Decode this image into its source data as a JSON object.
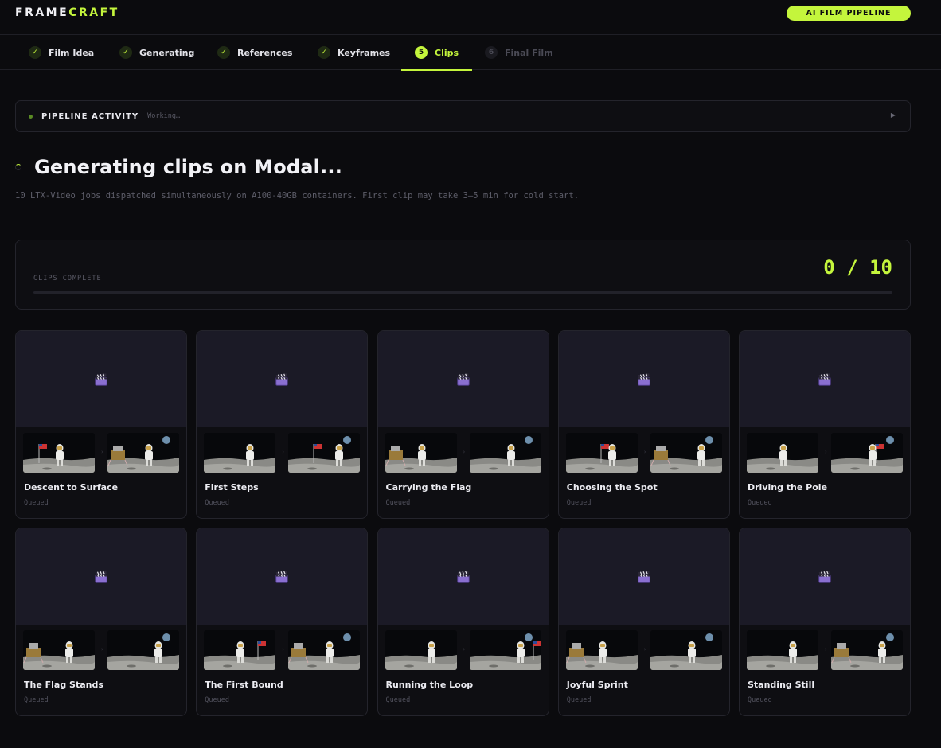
{
  "brand": {
    "part1": "FRAME",
    "part2": "CRAFT",
    "badge": "AI FILM PIPELINE"
  },
  "steps": [
    {
      "num": "✓",
      "label": "Film Idea",
      "state": "done"
    },
    {
      "num": "✓",
      "label": "Generating",
      "state": "done"
    },
    {
      "num": "✓",
      "label": "References",
      "state": "done"
    },
    {
      "num": "✓",
      "label": "Keyframes",
      "state": "done"
    },
    {
      "num": "5",
      "label": "Clips",
      "state": "active"
    },
    {
      "num": "6",
      "label": "Final Film",
      "state": "pending"
    }
  ],
  "activity": {
    "title": "PIPELINE ACTIVITY",
    "status": "Working…",
    "toggle_icon": "play-triangle-icon"
  },
  "main": {
    "heading": "Generating clips on Modal...",
    "description": "10 LTX-Video jobs dispatched simultaneously on A100-40GB containers. First clip may take 3–5 min for cold start."
  },
  "progress": {
    "label": "CLIPS COMPLETE",
    "count": "0 / 10",
    "fraction": 0.0
  },
  "clips": [
    {
      "title": "Descent to Surface",
      "status": "Queued",
      "icon": "clapperboard-icon"
    },
    {
      "title": "First Steps",
      "status": "Queued",
      "icon": "clapperboard-icon"
    },
    {
      "title": "Carrying the Flag",
      "status": "Queued",
      "icon": "clapperboard-icon"
    },
    {
      "title": "Choosing the Spot",
      "status": "Queued",
      "icon": "clapperboard-icon"
    },
    {
      "title": "Driving the Pole",
      "status": "Queued",
      "icon": "clapperboard-icon"
    },
    {
      "title": "The Flag Stands",
      "status": "Queued",
      "icon": "clapperboard-icon"
    },
    {
      "title": "The First Bound",
      "status": "Queued",
      "icon": "clapperboard-icon"
    },
    {
      "title": "Running the Loop",
      "status": "Queued",
      "icon": "clapperboard-icon"
    },
    {
      "title": "Joyful Sprint",
      "status": "Queued",
      "icon": "clapperboard-icon"
    },
    {
      "title": "Standing Still",
      "status": "Queued",
      "icon": "clapperboard-icon"
    }
  ],
  "colors": {
    "accent": "#c4f53c",
    "background": "#0b0b0e",
    "card": "#0e0e12",
    "preview": "#1b1a26"
  }
}
